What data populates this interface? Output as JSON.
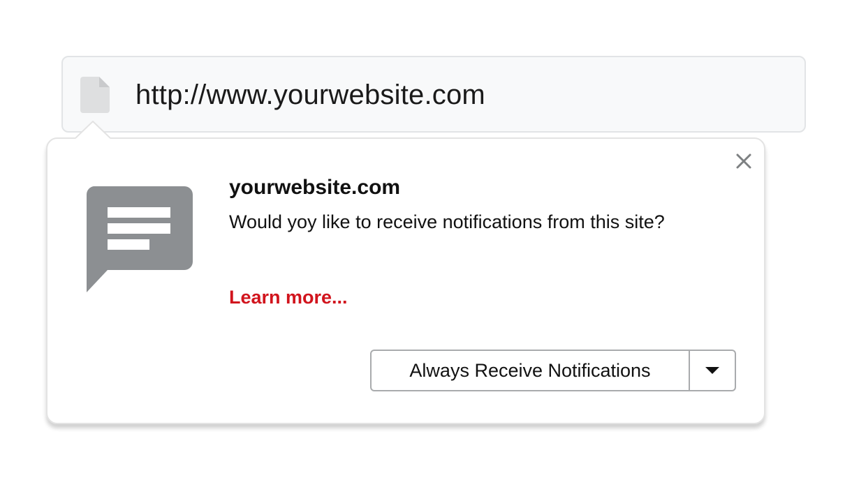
{
  "address_bar": {
    "url": "http://www.yourwebsite.com",
    "page_icon": "document-icon"
  },
  "popup": {
    "site_name": "yourwebsite.com",
    "message": "Would yoy like to receive notifications from this site?",
    "learn_more": "Learn more...",
    "primary_action": "Always Receive Notifications",
    "close_icon": "close-icon",
    "chat_icon": "chat-bubble-icon",
    "dropdown_icon": "caret-down-icon"
  },
  "colors": {
    "accent_link": "#d1141d",
    "icon_gray": "#8c8f92",
    "page_icon_gray": "#dedfe0",
    "address_bg": "#f8f9fa"
  }
}
